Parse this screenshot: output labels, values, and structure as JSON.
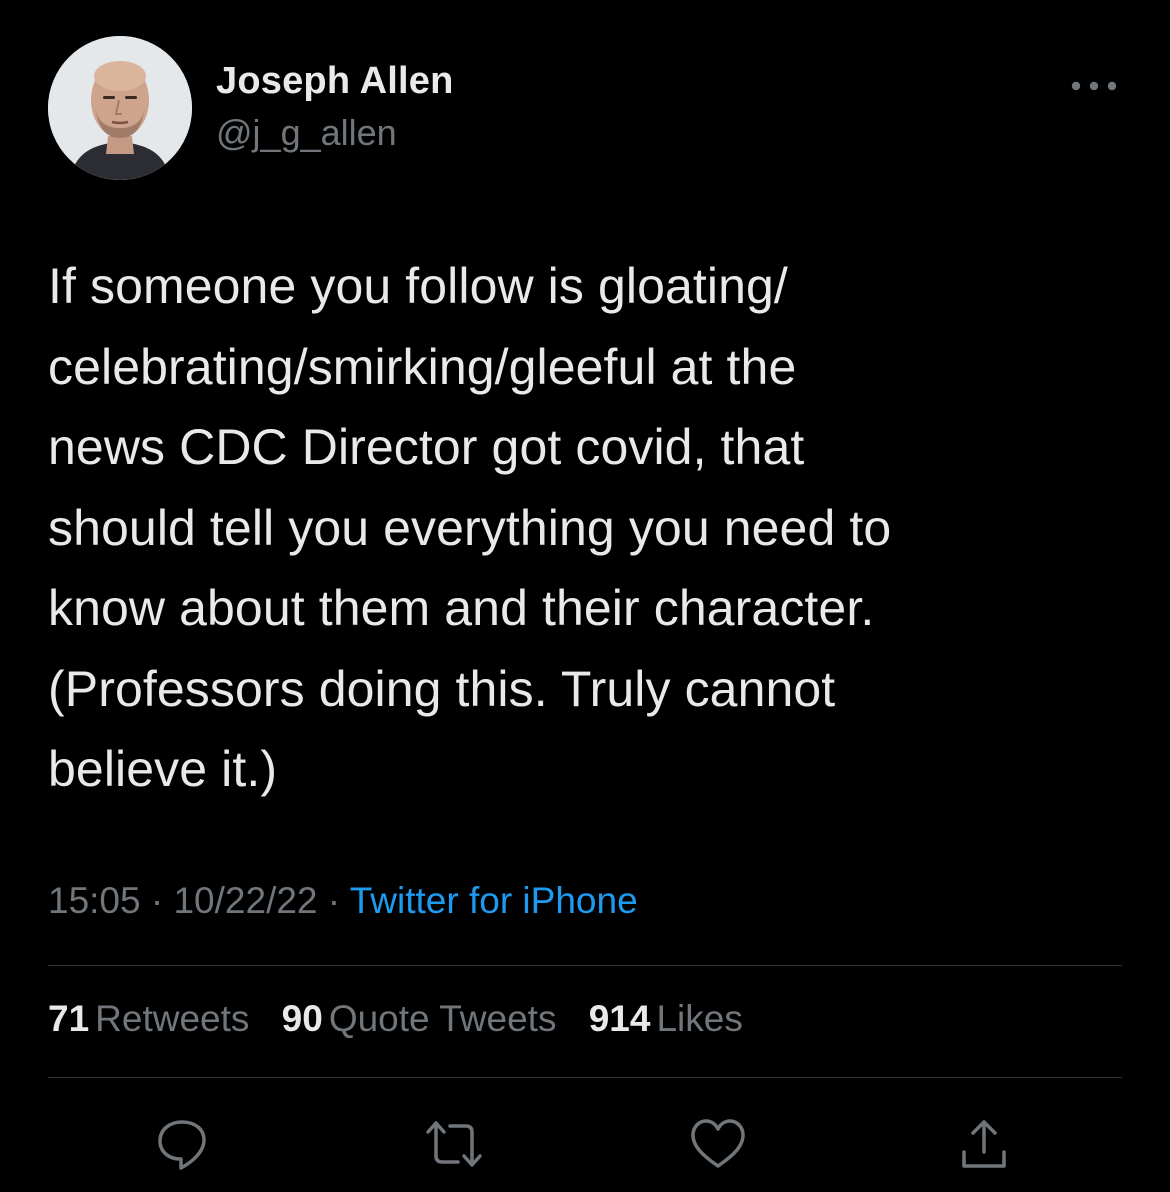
{
  "author": {
    "display_name": "Joseph Allen",
    "handle": "@j_g_allen",
    "avatar_icon": "avatar-photo"
  },
  "tweet": {
    "text": "If someone you follow is gloating/\ncelebrating/smirking/gleeful at the\nnews CDC Director got covid, that\nshould tell you everything you need to\nknow about them and their character.\n(Professors doing this. Truly cannot\nbelieve it.)"
  },
  "meta": {
    "time": "15:05",
    "separator": " · ",
    "date": "10/22/22",
    "source": "Twitter for iPhone"
  },
  "stats": {
    "retweets": {
      "count": "71",
      "label": "Retweets"
    },
    "quote_tweets": {
      "count": "90",
      "label": "Quote Tweets"
    },
    "likes": {
      "count": "914",
      "label": "Likes"
    }
  },
  "actions": {
    "reply_icon": "reply-icon",
    "retweet_icon": "retweet-icon",
    "like_icon": "heart-icon",
    "share_icon": "share-icon"
  },
  "colors": {
    "background": "#000000",
    "text_primary": "#e7e9ea",
    "text_secondary": "#71767b",
    "accent": "#1d9bf0",
    "divider": "#2f3336"
  }
}
